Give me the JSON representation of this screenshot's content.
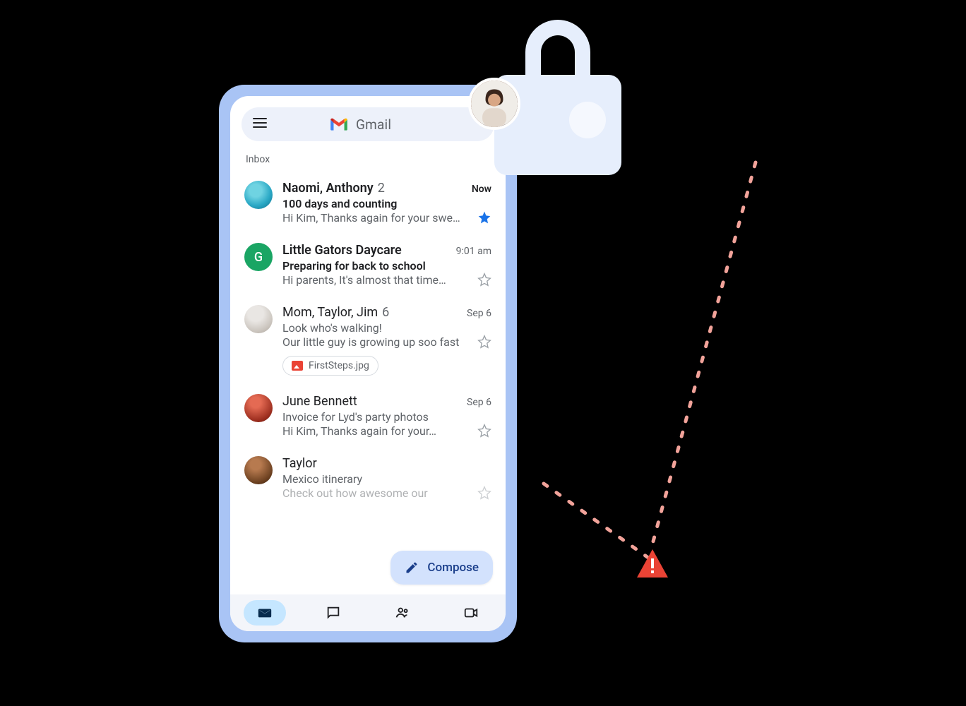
{
  "header": {
    "brand": "Gmail"
  },
  "section": "Inbox",
  "compose": "Compose",
  "messages": [
    {
      "sender": "Naomi, Anthony",
      "count": "2",
      "time": "Now",
      "subject": "100 days and counting",
      "snippet": "Hi Kim, Thanks again for your sweet…",
      "unread": true,
      "starred": true,
      "avatar": "photo-blue"
    },
    {
      "sender": "Little Gators Daycare",
      "count": "",
      "time": "9:01 am",
      "subject": "Preparing for back to school",
      "snippet": "Hi parents, It's almost that time…",
      "unread": true,
      "starred": false,
      "avatar": "letter-G"
    },
    {
      "sender": "Mom, Taylor, Jim",
      "count": "6",
      "time": "Sep 6",
      "subject": "Look who's walking!",
      "snippet": "Our little guy is growing up soo fast",
      "unread": false,
      "starred": false,
      "avatar": "photo-grey",
      "attachment": "FirstSteps.jpg"
    },
    {
      "sender": "June Bennett",
      "count": "",
      "time": "Sep 6",
      "subject": "Invoice for Lyd's party photos",
      "snippet": "Hi Kim, Thanks again for your…",
      "unread": false,
      "starred": false,
      "avatar": "photo-red"
    },
    {
      "sender": "Taylor",
      "count": "",
      "time": "",
      "subject": "Mexico itinerary",
      "snippet": "Check out how awesome our",
      "unread": false,
      "starred": false,
      "avatar": "photo-dark"
    }
  ],
  "avatar_letter": "G"
}
